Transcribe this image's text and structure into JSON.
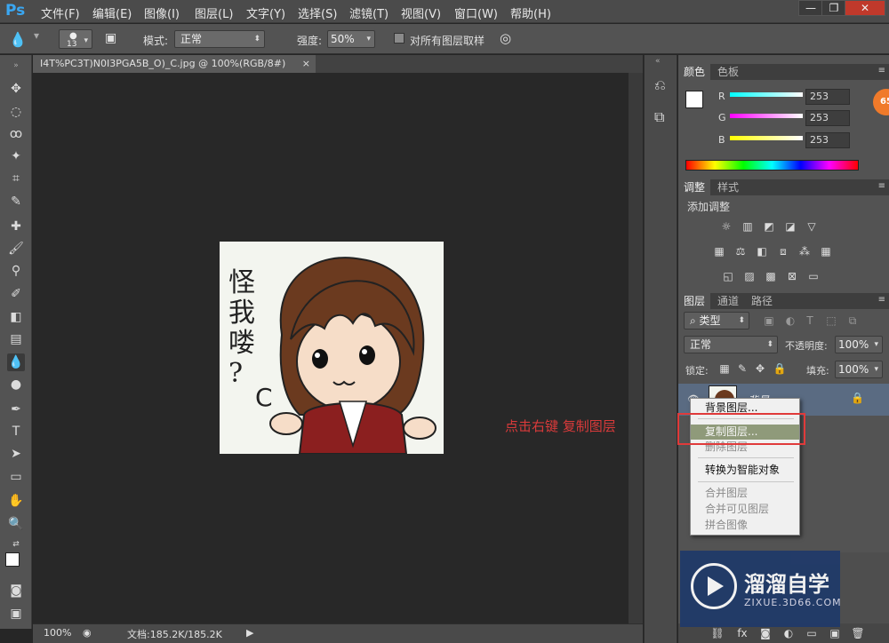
{
  "app": {
    "logo": "Ps"
  },
  "menu": [
    "文件(F)",
    "编辑(E)",
    "图像(I)",
    "图层(L)",
    "文字(Y)",
    "选择(S)",
    "滤镜(T)",
    "视图(V)",
    "窗口(W)",
    "帮助(H)"
  ],
  "window_controls": {
    "minimize": "—",
    "restore": "❐",
    "close": "✕"
  },
  "options": {
    "brush_size": "13",
    "mode_label": "模式:",
    "mode_value": "正常",
    "strength_label": "强度:",
    "strength_value": "50%",
    "sample_all_label": "对所有图层取样"
  },
  "document": {
    "tab_title": "I4T%PC3T)N0I3PGA5B_O)_C.jpg @ 100%(RGB/8#)",
    "tab_close": "×"
  },
  "status": {
    "zoom": "100%",
    "doc_size": "文档:185.2K/185.2K"
  },
  "annotation": "点击右键 复制图层",
  "color_panel": {
    "tabs": [
      "颜色",
      "色板"
    ],
    "r_label": "R",
    "g_label": "G",
    "b_label": "B",
    "r": "253",
    "g": "253",
    "b": "253",
    "badge": "65"
  },
  "adjust_panel": {
    "tabs": [
      "调整",
      "样式"
    ],
    "title": "添加调整"
  },
  "layers_panel": {
    "tabs": [
      "图层",
      "通道",
      "路径"
    ],
    "filter_label": "类型",
    "blend_mode": "正常",
    "opacity_label": "不透明度:",
    "opacity_value": "100%",
    "lock_label": "锁定:",
    "fill_label": "填充:",
    "fill_value": "100%",
    "layer_name": "背景"
  },
  "context_menu": {
    "items": [
      "背景图层...",
      "复制图层...",
      "删除图层",
      "转换为智能对象",
      "合并图层",
      "合并可见图层",
      "拼合图像"
    ]
  },
  "watermark": {
    "title": "溜溜自学",
    "url": "ZIXUE.3D66.COM"
  },
  "image_text": {
    "line1": "怪",
    "line2": "我",
    "line3": "喽",
    "line4": "?"
  },
  "colors": {
    "annotation": "#d93a3a",
    "highlight": "#8f9a7a",
    "redbox": "#e03a3a"
  }
}
